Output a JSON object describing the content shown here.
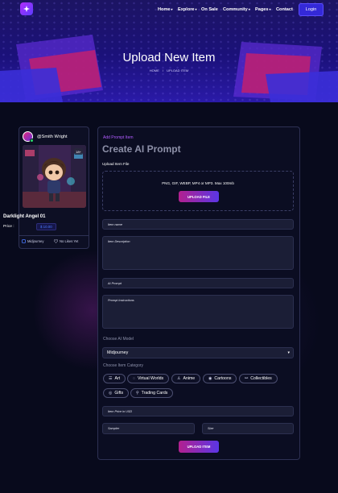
{
  "nav": {
    "items": [
      {
        "label": "Home",
        "caret": true
      },
      {
        "label": "Explore",
        "caret": true
      },
      {
        "label": "On Sale",
        "caret": false
      },
      {
        "label": "Community",
        "caret": true
      },
      {
        "label": "Pages",
        "caret": true
      },
      {
        "label": "Contact",
        "caret": false
      }
    ],
    "login_label": "Login",
    "caret_glyph": "▾"
  },
  "hero": {
    "title": "Upload New Item",
    "breadcrumb": {
      "home": "HOME",
      "separator": "/",
      "current": "UPLOAD ITEM"
    }
  },
  "card": {
    "author": "@Smith Wright",
    "title": "Darklight Angel 01",
    "price_label": "Price :",
    "price_value": "$ 10.00",
    "badge": "18+",
    "model": "Midjourney",
    "likes": "No Likes Yet"
  },
  "form": {
    "subtitle": "Add Prompt Item",
    "title": "Create AI Prompt",
    "upload_label": "Upload Item File",
    "file_types": "PNG, GIF, WEBP, MP4 or MP3. Max 100mb",
    "upload_file_button": "UPLOAD FILE",
    "item_name_placeholder": "Item name",
    "description_placeholder": "Item Description",
    "prompt_placeholder": "AI Prompt",
    "instructions_placeholder": "Prompt Instructions",
    "model_label": "Choose AI Model",
    "model_selected": "Midjourney",
    "category_label": "Choose Item Category",
    "categories": [
      {
        "label": "Art",
        "icon": "art-icon"
      },
      {
        "label": "Virtual Worlds",
        "icon": "virtual-worlds-icon"
      },
      {
        "label": "Anime",
        "icon": "anime-icon"
      },
      {
        "label": "Cartoons",
        "icon": "cartoons-icon"
      },
      {
        "label": "Collectibles",
        "icon": "collectibles-icon"
      },
      {
        "label": "Gifts",
        "icon": "gifts-icon"
      },
      {
        "label": "Trading Cards",
        "icon": "trading-cards-icon"
      }
    ],
    "price_placeholder": "Item Price in USD",
    "sampler_placeholder": "Sampler",
    "size_placeholder": "Size",
    "submit_button": "UPLOAD ITEM"
  },
  "colors": {
    "accent": "#3429d8",
    "gradient_start": "#b2208f",
    "gradient_end": "#5b36e6",
    "subtitle_purple": "#b15cff",
    "price_blue": "#4b7bff"
  }
}
